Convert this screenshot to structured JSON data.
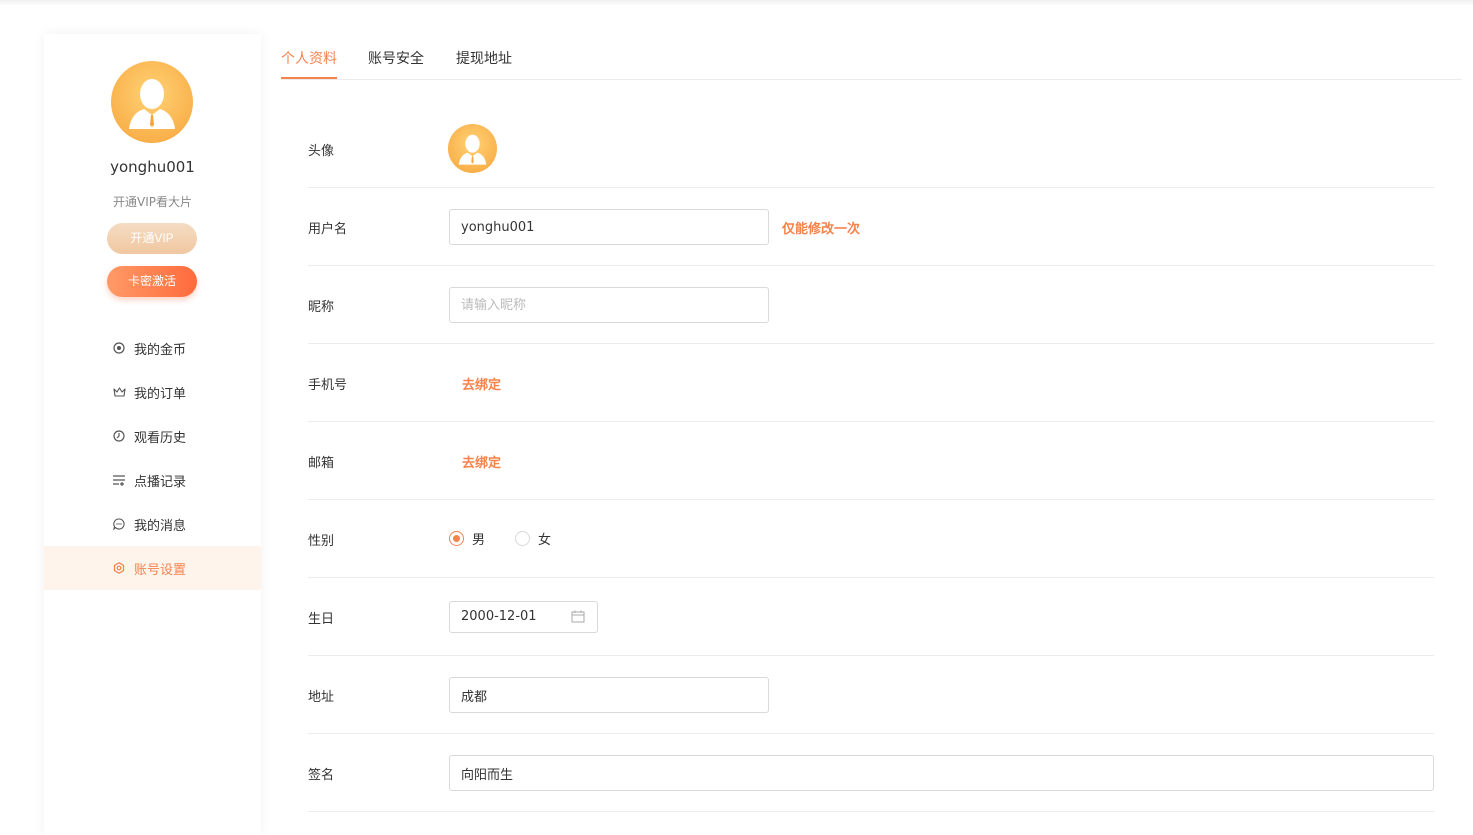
{
  "sidebar": {
    "username": "yonghu001",
    "subtitle": "开通VIP看大片",
    "vip_button": "开通VIP",
    "card_button": "卡密激活",
    "menu": [
      {
        "label": "我的金币",
        "icon": "coin-icon"
      },
      {
        "label": "我的订单",
        "icon": "crown-icon"
      },
      {
        "label": "观看历史",
        "icon": "clock-icon"
      },
      {
        "label": "点播记录",
        "icon": "list-icon"
      },
      {
        "label": "我的消息",
        "icon": "message-icon"
      },
      {
        "label": "账号设置",
        "icon": "settings-icon",
        "active": true
      }
    ]
  },
  "tabs": [
    {
      "label": "个人资料",
      "active": true
    },
    {
      "label": "账号安全"
    },
    {
      "label": "提现地址"
    }
  ],
  "form": {
    "avatar_label": "头像",
    "username_label": "用户名",
    "username_value": "yonghu001",
    "username_note": "仅能修改一次",
    "nickname_label": "昵称",
    "nickname_placeholder": "请输入昵称",
    "phone_label": "手机号",
    "phone_action": "去绑定",
    "email_label": "邮箱",
    "email_action": "去绑定",
    "gender_label": "性别",
    "gender_options": [
      "男",
      "女"
    ],
    "gender_selected": "男",
    "birthday_label": "生日",
    "birthday_value": "2000-12-01",
    "address_label": "地址",
    "address_value": "成都",
    "signature_label": "签名",
    "signature_value": "向阳而生"
  },
  "colors": {
    "accent": "#f5834c",
    "active_bg": "#fff4ec",
    "avatar": "#f7a43b"
  }
}
